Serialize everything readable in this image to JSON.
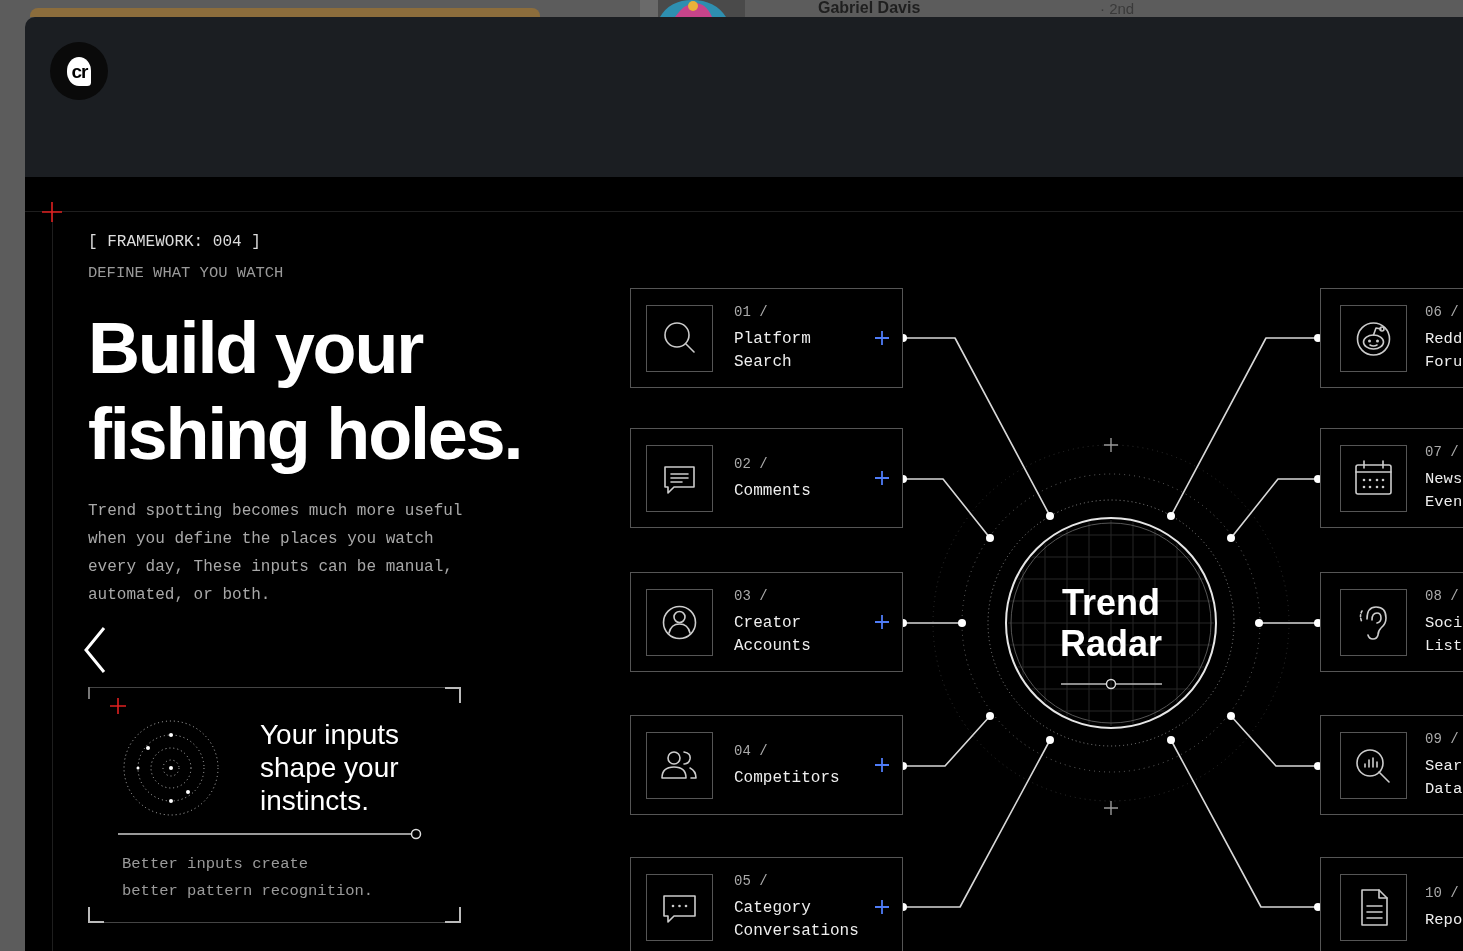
{
  "background_post": {
    "author": "Gabriel Davis",
    "connection": "· 2nd"
  },
  "viewer": {
    "logo": "cr"
  },
  "slide": {
    "tag": "[ FRAMEWORK: 004 ]",
    "subtitle": "DEFINE WHAT YOU WATCH",
    "headline": "Build your\nfishing holes.",
    "body": "Trend spotting becomes much more useful\nwhen you define the places you watch\nevery day, These inputs can be manual,\nautomated, or both.",
    "callout": {
      "title": "Your inputs\nshape your\ninstincts.",
      "text": "Better inputs create\nbetter pattern recognition."
    }
  },
  "diagram": {
    "center": "Trend\nRadar",
    "left_inputs": [
      {
        "number": "01 /",
        "label": "Platform\nSearch"
      },
      {
        "number": "02 /",
        "label": "Comments"
      },
      {
        "number": "03 /",
        "label": "Creator\nAccounts"
      },
      {
        "number": "04 /",
        "label": "Competitors"
      },
      {
        "number": "05 /",
        "label": "Category\nConversations"
      }
    ],
    "right_inputs": [
      {
        "number": "06 /",
        "label": "Redd\nForu"
      },
      {
        "number": "07 /",
        "label": "News\nEven"
      },
      {
        "number": "08 /",
        "label": "Soci\nList"
      },
      {
        "number": "09 /",
        "label": "Sear\nData"
      },
      {
        "number": "10 /",
        "label": "Repo"
      }
    ]
  }
}
